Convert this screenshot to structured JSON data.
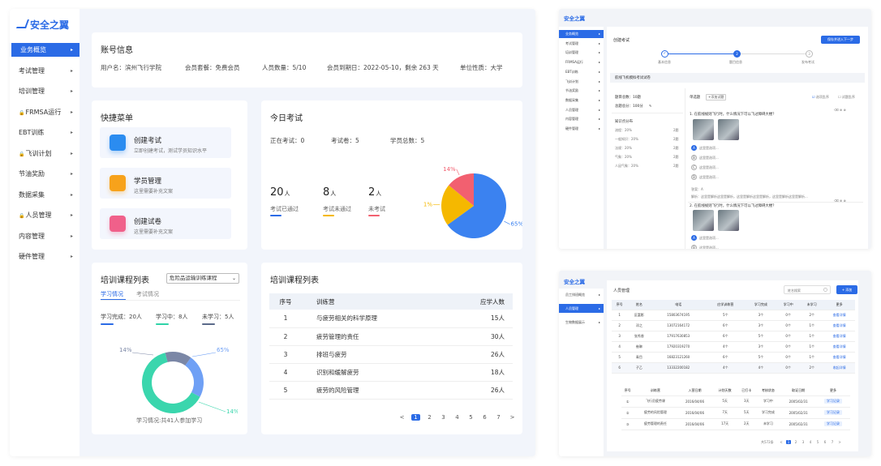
{
  "brand": {
    "name": "安全之翼"
  },
  "sidebar": {
    "items": [
      {
        "label": "业务概览",
        "active": true,
        "lock": false
      },
      {
        "label": "考试管理",
        "lock": false
      },
      {
        "label": "培训管理",
        "lock": false
      },
      {
        "label": "FRMSA运行",
        "lock": true
      },
      {
        "label": "EBT训练",
        "lock": false
      },
      {
        "label": "飞训计划",
        "lock": true
      },
      {
        "label": "节油奖励",
        "lock": false
      },
      {
        "label": "数据采集",
        "lock": false
      },
      {
        "label": "人员管理",
        "lock": true
      },
      {
        "label": "内容管理",
        "lock": false
      },
      {
        "label": "硬件管理",
        "lock": false
      }
    ]
  },
  "account": {
    "title": "账号信息",
    "username": "用户名：滨州飞行学院",
    "plan": "会员套餐：免费会员",
    "people": "人员数量：5/10",
    "expiry": "会员到期日：2022-05-10，剩余 263 天",
    "unit": "单位性质：大学"
  },
  "quick": {
    "title": "快捷菜单",
    "items": [
      {
        "title": "创建考试",
        "sub": "立即创建考试，测试学员知识水平",
        "color": "#2b8cf0"
      },
      {
        "title": "学员管理",
        "sub": "这里需要补充文案",
        "color": "#f7a21b"
      },
      {
        "title": "创建试卷",
        "sub": "这里需要补充文案",
        "color": "#f0608a"
      }
    ]
  },
  "today": {
    "title": "今日考试",
    "ongoing": "正在考试：0",
    "papers": "考试卷：5",
    "students": "学员总数：5",
    "stats": [
      {
        "value": "20",
        "unit": "人",
        "label": "考试已通过",
        "color": "#2b6be6"
      },
      {
        "value": "8",
        "unit": "人",
        "label": "考试未通过",
        "color": "#f5b800"
      },
      {
        "value": "2",
        "unit": "人",
        "label": "未考试",
        "color": "#f26070"
      }
    ],
    "chart_data": {
      "type": "pie",
      "categories": [
        "考试已通过",
        "考试未通过",
        "未考试"
      ],
      "values": [
        65,
        21,
        14
      ],
      "labels": [
        "65%",
        "21%",
        "14%"
      ],
      "colors": [
        "#3b82f0",
        "#f5b800",
        "#f26070"
      ]
    }
  },
  "train_left": {
    "title": "培训课程列表",
    "select": "危险品运输训练课程",
    "tabs": [
      "学习情况",
      "考试情况"
    ],
    "legend": [
      {
        "label": "学习完成：20人",
        "color": "#2b6be6"
      },
      {
        "label": "学习中：8人",
        "color": "#2fd3a8"
      },
      {
        "label": "未学习：5人",
        "color": "#5b6a8a"
      }
    ],
    "footer": "学习情况:共41人参加学习",
    "chart_data": {
      "type": "pie",
      "categories": [
        "学习完成",
        "学习中",
        "未学习"
      ],
      "values": [
        65,
        14,
        14
      ],
      "labels": [
        "65%",
        "14%",
        "14%"
      ],
      "colors": [
        "#6fa0f5",
        "#3ad6ad",
        "#7b87a6"
      ]
    }
  },
  "train_right": {
    "title": "培训课程列表",
    "headers": [
      "序号",
      "训练营",
      "应学人数"
    ],
    "rows": [
      [
        "1",
        "与疲劳相关的科学原理",
        "15人"
      ],
      [
        "2",
        "疲劳管理的责任",
        "30人"
      ],
      [
        "3",
        "排班与疲劳",
        "26人"
      ],
      [
        "4",
        "识别和缓解疲劳",
        "18人"
      ],
      [
        "5",
        "疲劳的风险管理",
        "26人"
      ]
    ],
    "pager": [
      "<",
      "1",
      "2",
      "3",
      "4",
      "5",
      "6",
      "7",
      ">"
    ]
  },
  "mini1": {
    "nav": [
      "业务概览",
      "考试管理",
      "培训管理",
      "FRMSA运行",
      "EBT训练",
      "飞训计划",
      "节油奖励",
      "数据采集",
      "人员管理",
      "内容管理",
      "硬件管理"
    ],
    "title": "创建考试",
    "next_btn": "保存并进入下一步",
    "steps": [
      "基本信息",
      "题目信息",
      "发布考试"
    ],
    "section": "航线飞机模拟考试试卷",
    "total": "题目总数：10题",
    "score": "总题总分：100分",
    "dist_title": "知识点分布",
    "dist": [
      [
        "流程：20%",
        "2题"
      ],
      [
        "一般知识：20%",
        "2题"
      ],
      [
        "法规：20%",
        "2题"
      ],
      [
        "气象：20%",
        "2题"
      ],
      [
        "人因气象：20%",
        "2题"
      ]
    ],
    "qtype": "单选题",
    "add": "+添加试题",
    "opt1": "选项乱序",
    "opt2": "试题乱序",
    "q1": "1. 在航线规则飞行时，什么情况下可以飞过障碍大楼？",
    "opts": [
      "这里是选项...",
      "这里是选项...",
      "这里是选项...",
      "这里是选项..."
    ],
    "answer": "答案：A",
    "explain": "解析：这里是解析这里是解析，这里是解析这里是解析，这里是解析这里是解析...",
    "q2": "2. 在航线规则飞行时，什么情况下可以飞过障碍大楼？",
    "opts2": [
      "这里是选项...",
      "这里是选项...",
      "这里是选项..."
    ]
  },
  "mini2": {
    "nav": [
      "员工排班概览",
      "人员管理",
      "生物数据展示"
    ],
    "title": "人员管理",
    "search": "姓名搜索",
    "add": "+ 添加",
    "headers": [
      "序号",
      "姓名",
      "电话",
      "应学训练营",
      "学习完成",
      "学习中",
      "未学习",
      "更多"
    ],
    "rows": [
      [
        "1",
        "区富影",
        "15803674195",
        "5个",
        "3个",
        "0个",
        "2个",
        "查看详情"
      ],
      [
        "2",
        "邓之",
        "13072164172",
        "6个",
        "3个",
        "0个",
        "1个",
        "查看详情"
      ],
      [
        "3",
        "张秀香",
        "17917630853",
        "6个",
        "5个",
        "0个",
        "1个",
        "查看详情"
      ],
      [
        "4",
        "崔琳",
        "17920319270",
        "4个",
        "3个",
        "0个",
        "1个",
        "查看详情"
      ],
      [
        "5",
        "青目",
        "16823121260",
        "6个",
        "5个",
        "0个",
        "1个",
        "查看详情"
      ],
      [
        "6",
        "子乙",
        "13332200182",
        "4个",
        "4个",
        "0个",
        "2个",
        "收起详情"
      ]
    ],
    "sub_headers": [
      "序号",
      "训练营",
      "入营日期",
      "计划天数",
      "已打卡",
      "考核状态",
      "取证日期",
      "更多"
    ],
    "sub_rows": [
      [
        "①",
        "飞行员疲劳课",
        "2016/04/06",
        "5天",
        "3天",
        "学习中",
        "2005/02/31",
        "学习记录"
      ],
      [
        "②",
        "疲劳的风险管理",
        "2016/04/06",
        "7天",
        "5天",
        "学习完成",
        "2005/02/31",
        "学习记录"
      ],
      [
        "③",
        "疲劳管理的责任",
        "2016/04/06",
        "17天",
        "2天",
        "未学习",
        "2005/02/31",
        "学习记录"
      ]
    ],
    "total": "共572条",
    "pager": [
      "<",
      "1",
      "2",
      "3",
      "4",
      "5",
      "6",
      "7",
      ">"
    ]
  }
}
